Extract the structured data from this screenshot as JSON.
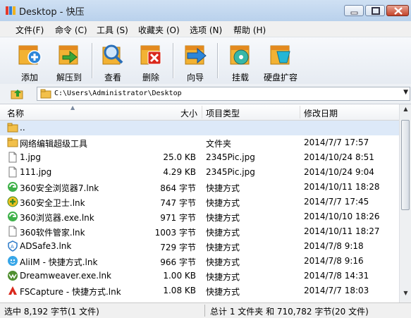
{
  "window": {
    "title": "Desktop - 快压"
  },
  "menu": [
    "文件(F)",
    "命令 (C)",
    "工具 (S)",
    "收藏夹 (O)",
    "选项 (N)",
    "帮助 (H)"
  ],
  "toolbar": [
    {
      "label": "添加",
      "icon": "add-archive-icon"
    },
    {
      "label": "解压到",
      "icon": "extract-to-icon"
    },
    {
      "label": "查看",
      "icon": "view-magnifier-icon"
    },
    {
      "label": "删除",
      "icon": "delete-icon"
    },
    {
      "label": "向导",
      "icon": "wizard-arrow-icon"
    },
    {
      "label": "挂载",
      "icon": "mount-disk-icon"
    },
    {
      "label": "硬盘扩容",
      "icon": "disk-expand-icon"
    }
  ],
  "address": {
    "path": "C:\\Users\\Administrator\\Desktop"
  },
  "columns": {
    "name": "名称",
    "size": "大小",
    "type": "项目类型",
    "modified": "修改日期"
  },
  "files": [
    {
      "name": "..",
      "size": "",
      "type": "",
      "date": "",
      "icon": "folder-icon"
    },
    {
      "name": "网络编辑超级工具",
      "size": "",
      "type": "文件夹",
      "date": "2014/7/7 17:57",
      "icon": "folder-icon"
    },
    {
      "name": "1.jpg",
      "size": "25.0 KB",
      "type": "2345Pic.jpg",
      "date": "2014/10/24 8:51",
      "icon": "file-icon"
    },
    {
      "name": "111.jpg",
      "size": "4.29 KB",
      "type": "2345Pic.jpg",
      "date": "2014/10/24 9:04",
      "icon": "file-icon"
    },
    {
      "name": "360安全浏览器7.lnk",
      "size": "864 字节",
      "type": "快捷方式",
      "date": "2014/10/11 18:28",
      "icon": "browser-360-icon"
    },
    {
      "name": "360安全卫士.lnk",
      "size": "747 字节",
      "type": "快捷方式",
      "date": "2014/7/7 17:45",
      "icon": "security-360-icon"
    },
    {
      "name": "360浏览器.exe.lnk",
      "size": "971 字节",
      "type": "快捷方式",
      "date": "2014/10/10 18:26",
      "icon": "browser-360-icon"
    },
    {
      "name": "360软件管家.lnk",
      "size": "1003 字节",
      "type": "快捷方式",
      "date": "2014/10/11 18:27",
      "icon": "file-icon"
    },
    {
      "name": "ADSafe3.lnk",
      "size": "729 字节",
      "type": "快捷方式",
      "date": "2014/7/8 9:18",
      "icon": "shield-icon"
    },
    {
      "name": "AliIM - 快捷方式.lnk",
      "size": "966 字节",
      "type": "快捷方式",
      "date": "2014/7/8 9:16",
      "icon": "aliim-icon"
    },
    {
      "name": "Dreamweaver.exe.lnk",
      "size": "1.00 KB",
      "type": "快捷方式",
      "date": "2014/7/8 14:31",
      "icon": "dreamweaver-icon"
    },
    {
      "name": "FSCapture - 快捷方式.lnk",
      "size": "1.08 KB",
      "type": "快捷方式",
      "date": "2014/7/7 18:03",
      "icon": "fscapture-icon"
    }
  ],
  "status": {
    "left": "选中 8,192 字节(1 文件)",
    "right": "总计 1 文件夹 和 710,782 字节(20 文件)"
  }
}
